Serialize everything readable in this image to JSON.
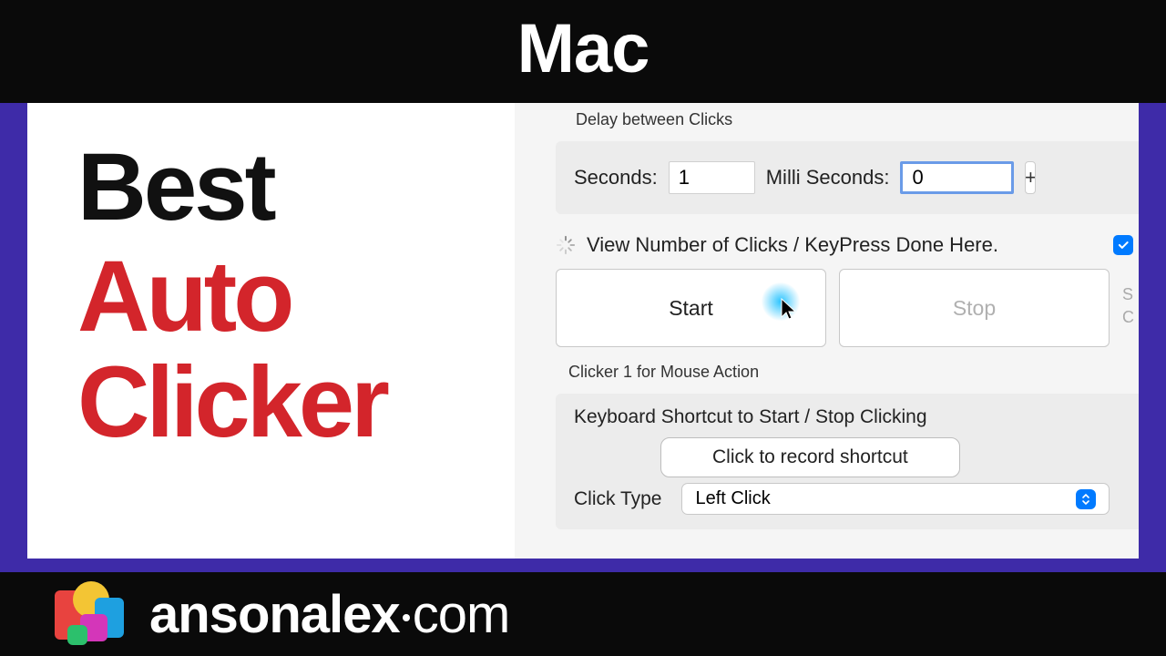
{
  "banner": {
    "title": "Mac"
  },
  "headline": {
    "word1": "Best",
    "word2": "Auto",
    "word3": "Clicker"
  },
  "app": {
    "delay": {
      "group_label": "Delay between Clicks",
      "seconds_label": "Seconds:",
      "seconds_value": "1",
      "ms_label": "Milli Seconds:",
      "ms_value": "0",
      "plus": "+"
    },
    "status_text": "View Number of Clicks / KeyPress Done Here.",
    "start_label": "Start",
    "stop_label": "Stop",
    "edge_hint": "S\nC",
    "clicker_section_label": "Clicker 1 for Mouse Action",
    "shortcut": {
      "title": "Keyboard Shortcut to Start / Stop Clicking",
      "record_btn": "Click to record shortcut"
    },
    "click_type_label": "Click Type",
    "click_type_value": "Left Click"
  },
  "footer": {
    "brand_a": "ansonalex",
    "brand_b": "com"
  }
}
